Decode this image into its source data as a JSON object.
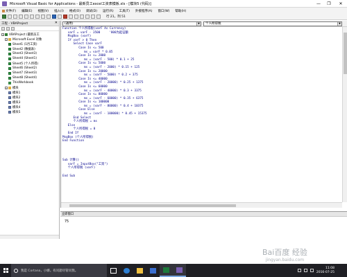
{
  "titlebar": {
    "title": "Microsoft Visual Basic for Applications - 最新员工excel工资表模板.xls - [模块5 (代码)]",
    "min": "—",
    "max": "❐",
    "close": "✕"
  },
  "menubar": {
    "items": [
      "文件(F)",
      "编辑(E)",
      "视图(V)",
      "插入(I)",
      "格式(O)",
      "调试(D)",
      "运行(R)",
      "工具(T)",
      "外接程序(A)",
      "窗口(W)",
      "帮助(H)"
    ]
  },
  "toolbar": {
    "position": "行 21，列 51"
  },
  "project": {
    "header": "工程 - VBAProject",
    "close": "✕",
    "nodes": [
      {
        "label": "VBAProject (最新员工",
        "icon": "project-icon",
        "depth": 0,
        "expander": "−"
      },
      {
        "label": "Microsoft Excel 对象",
        "icon": "folder-icon",
        "depth": 1,
        "expander": "−"
      },
      {
        "label": "Sheet1 (1月工资)",
        "icon": "sheet-icon",
        "depth": 2
      },
      {
        "label": "Sheet2 (数据表)",
        "icon": "sheet-icon",
        "depth": 2
      },
      {
        "label": "Sheet3 (Sheet3)",
        "icon": "sheet-icon",
        "depth": 2
      },
      {
        "label": "Sheet4 (Sheet1)",
        "icon": "sheet-icon",
        "depth": 2
      },
      {
        "label": "Sheet5 (个人所得)",
        "icon": "sheet-icon",
        "depth": 2
      },
      {
        "label": "Sheet6 (Sheet2)",
        "icon": "sheet-icon",
        "depth": 2
      },
      {
        "label": "Sheet7 (Sheet3)",
        "icon": "sheet-icon",
        "depth": 2
      },
      {
        "label": "Sheet8 (Sheet4)",
        "icon": "sheet-icon",
        "depth": 2
      },
      {
        "label": "ThisWorkbook",
        "icon": "workbook-icon",
        "depth": 2
      },
      {
        "label": "模块",
        "icon": "folder-icon",
        "depth": 1,
        "expander": "−"
      },
      {
        "label": "模块1",
        "icon": "module-icon",
        "depth": 2
      },
      {
        "label": "模块2",
        "icon": "module-icon",
        "depth": 2
      },
      {
        "label": "模块3",
        "icon": "module-icon",
        "depth": 2
      },
      {
        "label": "模块4",
        "icon": "module-icon",
        "depth": 2
      },
      {
        "label": "模块5",
        "icon": "module-icon",
        "depth": 2
      }
    ]
  },
  "code": {
    "object_combo": "(通用)",
    "proc_combo": "个人所得税",
    "lines": [
      "Function 个人所得税(varF As Currency)",
      "   varF = varF - 3500     '800为起征额",
      "   MsgBox (varF)",
      "   If varF > 0 Then",
      "      Select Case varF",
      "         Case Is <= 500",
      "            ms = varF * 0.05",
      "         Case Is <= 2000",
      "            ms = (varF - 500) * 0.1 + 25",
      "         Case Is <= 5000",
      "            ms = (varF - 2000) * 0.15 + 125",
      "         Case Is <= 20000",
      "            ms = (varF - 5000) * 0.2 + 375",
      "         Case Is <= 40000",
      "            ms = (varF - 20000) * 0.25 + 1375",
      "         Case Is <= 60000",
      "            ms = (varF - 40000) * 0.3 + 3375",
      "         Case Is <= 80000",
      "            ms = (varF - 60000) * 0.35 + 6375",
      "         Case Is <= 100000",
      "            ms = (varF - 80000) * 0.4 + 10375",
      "         Case Else",
      "            ms = (varF - 100000) * 0.45 + 15375",
      "      End Select",
      "      个人所得税 = ms",
      "   Else",
      "      个人所得税 = 0",
      "   End If",
      "MsgBox (个人所得税)",
      "End Function",
      "",
      "",
      "",
      "",
      "Sub 计算()",
      "   varF = InputBox(\"工资\")",
      "   个人所得税 (varF)",
      "",
      "End Sub"
    ]
  },
  "immediate": {
    "header": "立即窗口",
    "text": "75"
  },
  "taskbar": {
    "search_placeholder": "我是 Cortana，小娜。有问题尽管问我。",
    "time": "11:08",
    "date": "2016-07-25"
  },
  "watermark": {
    "text": "Bai百度 经验",
    "url": "jingyan.baidu.com"
  }
}
